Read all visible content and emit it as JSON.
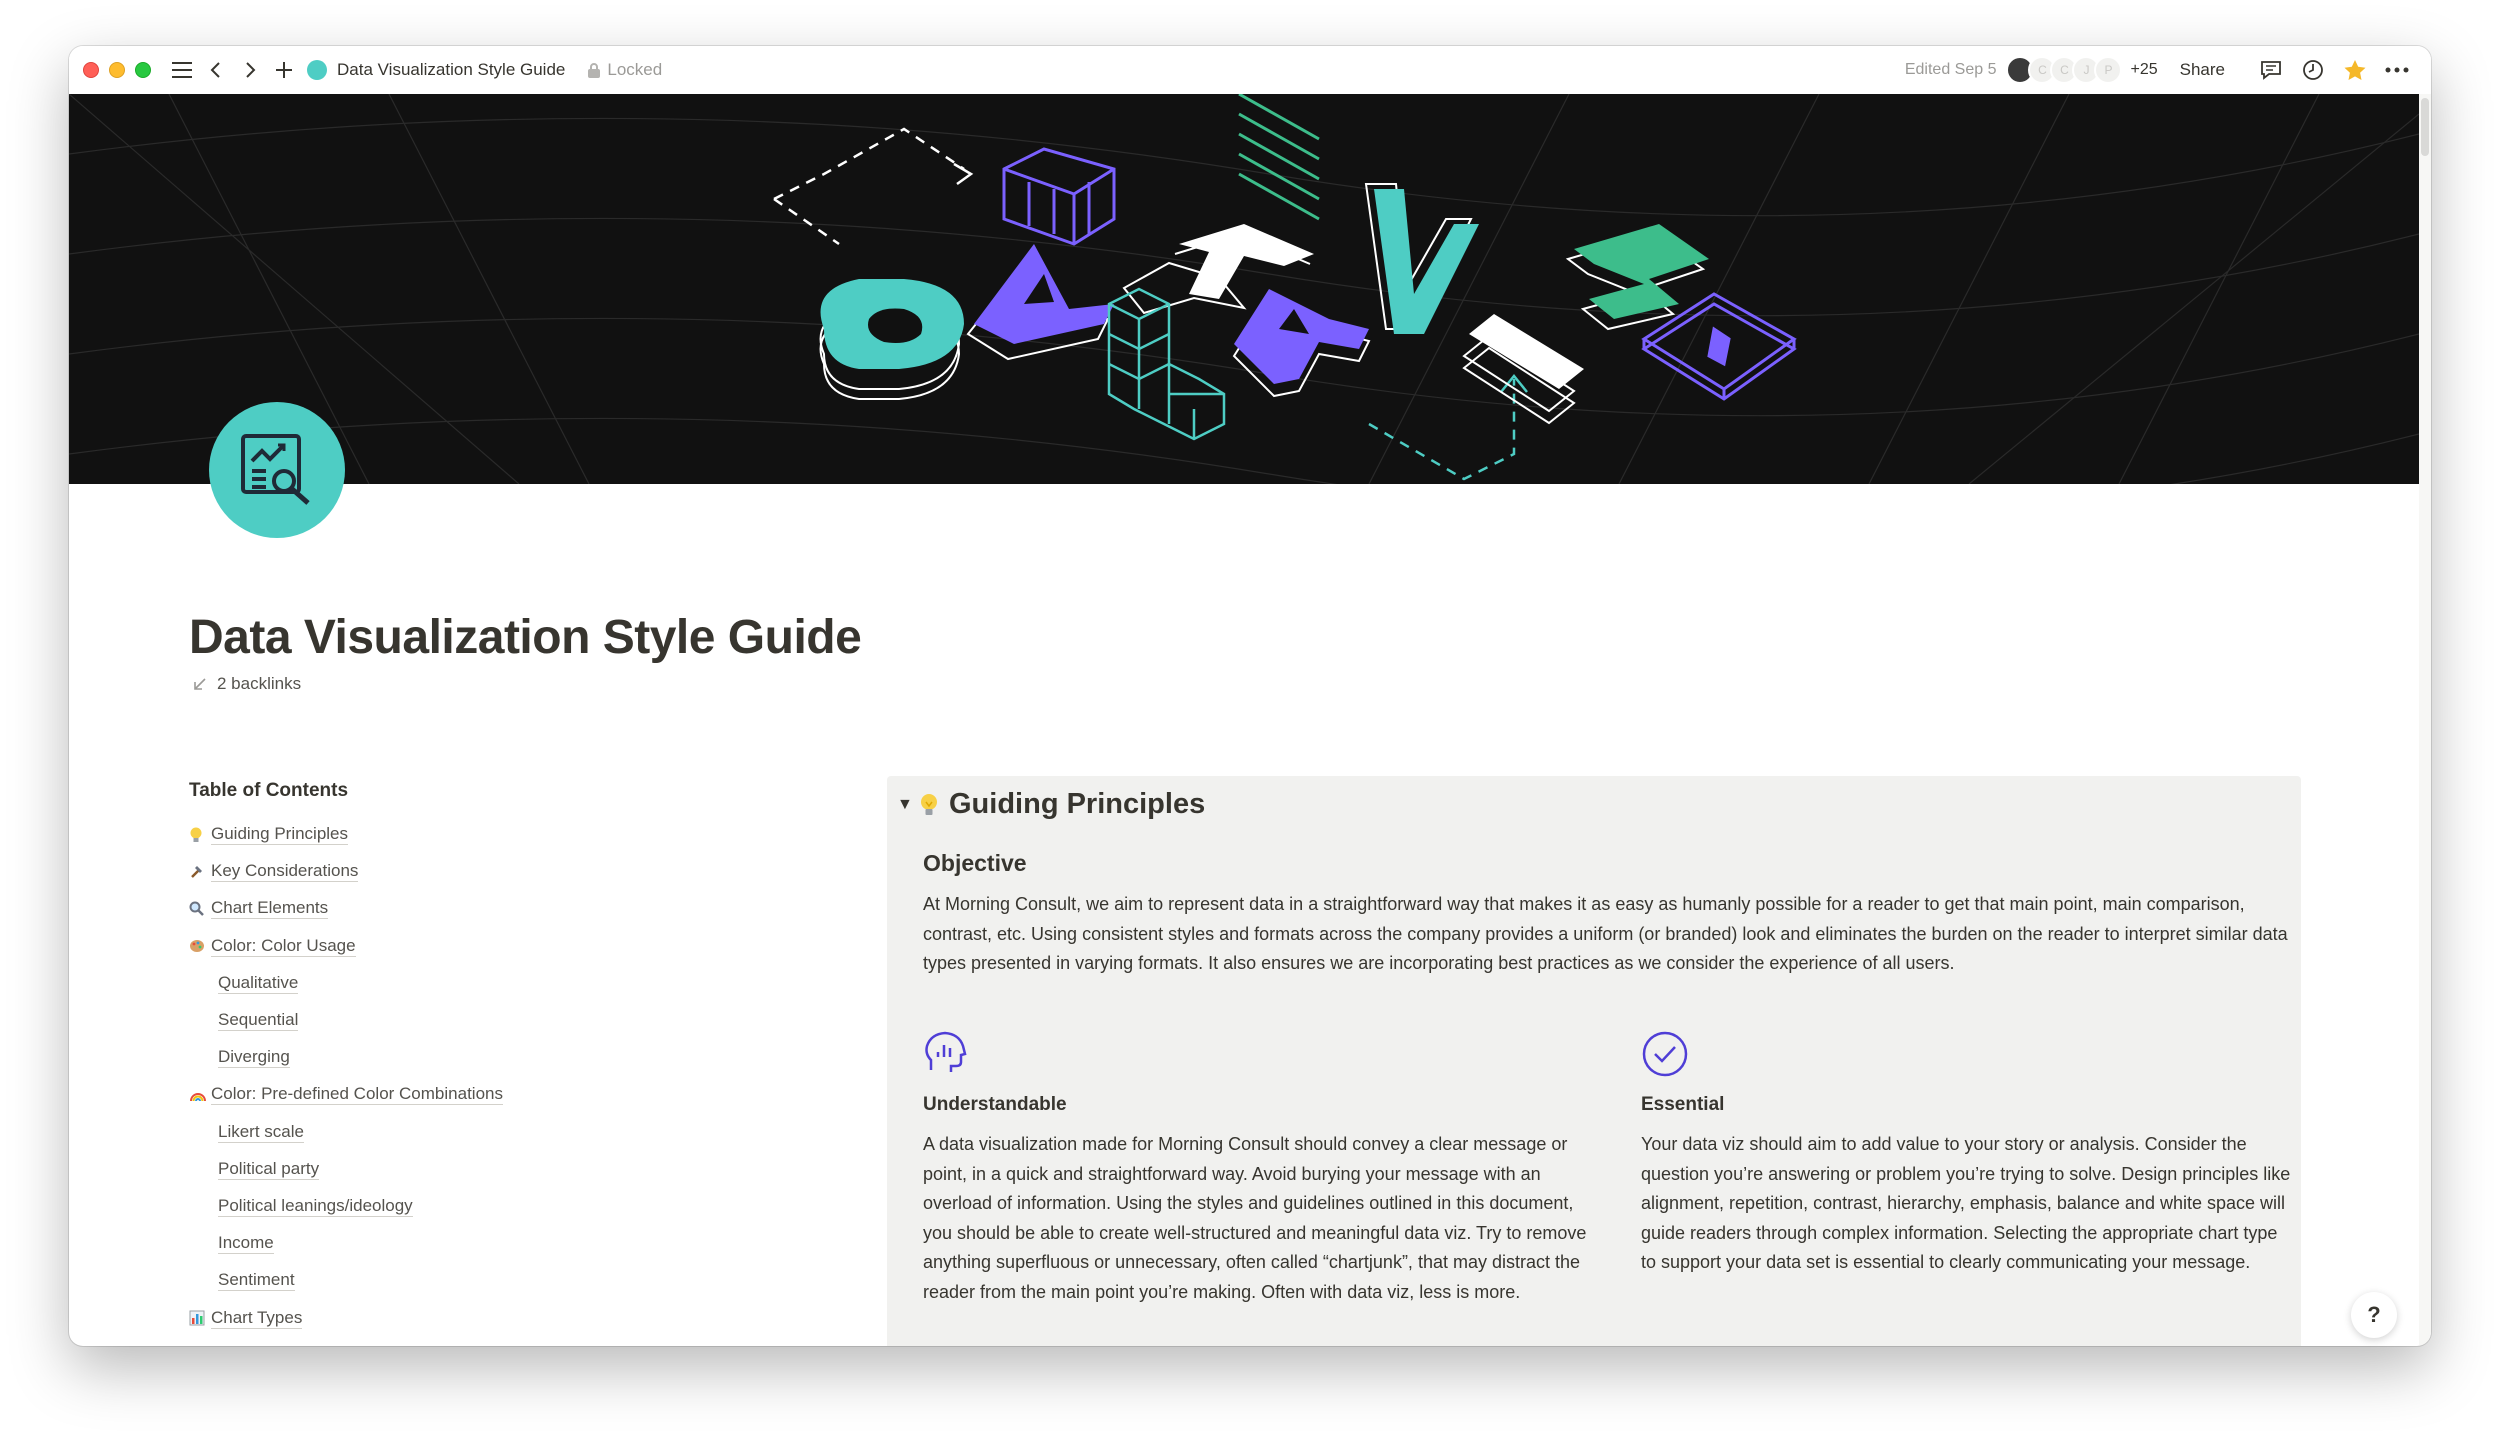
{
  "titlebar": {
    "page_title": "Data Visualization Style Guide",
    "lock_label": "Locked",
    "edited": "Edited Sep 5",
    "avatars": [
      "C",
      "C",
      "J",
      "P"
    ],
    "more_count": "+25",
    "share_label": "Share"
  },
  "page": {
    "title": "Data Visualization Style Guide",
    "backlinks": "2 backlinks"
  },
  "toc": {
    "heading": "Table of Contents",
    "items": [
      {
        "label": "Guiding Principles",
        "icon": "lightbulb-icon"
      },
      {
        "label": "Key Considerations",
        "icon": "hammer-icon"
      },
      {
        "label": "Chart Elements",
        "icon": "magnifier-icon"
      },
      {
        "label": "Color: Color Usage",
        "icon": "palette-icon"
      },
      {
        "label": "Qualitative"
      },
      {
        "label": "Sequential"
      },
      {
        "label": "Diverging"
      },
      {
        "label": "Color: Pre-defined Color Combinations",
        "icon": "rainbow-icon"
      },
      {
        "label": "Likert scale"
      },
      {
        "label": "Political party"
      },
      {
        "label": "Political leanings/ideology"
      },
      {
        "label": "Income"
      },
      {
        "label": "Sentiment"
      },
      {
        "label": "Chart Types",
        "icon": "bar-chart-icon"
      }
    ]
  },
  "principles": {
    "title": "Guiding Principles",
    "objective_heading": "Objective",
    "objective_text": "At Morning Consult, we aim to represent data in a straightforward way that makes it as easy as humanly possible for a reader to get that main point, main comparison, contrast, etc. Using consistent styles and formats across the company provides a uniform (or branded) look and eliminates the burden on the reader to interpret similar data types presented in varying formats. It also ensures we are incorporating best practices as we consider the experience of all users.",
    "understandable_heading": "Understandable",
    "understandable_text": "A data visualization made for Morning Consult should convey a clear message or point, in a quick and straightforward way. Avoid burying your message with an overload of information. Using the styles and guidelines outlined in this document, you should be able to create well-structured and meaningful data viz. Try to remove anything superfluous or unnecessary, often called “chartjunk”, that may distract the reader from the main point you’re making. Often with data viz, less is more.",
    "essential_heading": "Essential",
    "essential_text": "Your data viz should aim to add value to your story or analysis. Consider the question you’re answering or problem you’re trying to solve. Design principles like alignment, repetition, contrast, hierarchy, emphasis, balance and white space will guide readers through complex information. Selecting the appropriate chart type to support your data set is essential to clearly communicating your message."
  },
  "help_label": "?",
  "colors": {
    "teal": "#4ecdc4",
    "purple": "#7b61ff",
    "green": "#3dbd8b",
    "callout_bg": "#f1f1ef",
    "cover_bg": "#111111"
  }
}
